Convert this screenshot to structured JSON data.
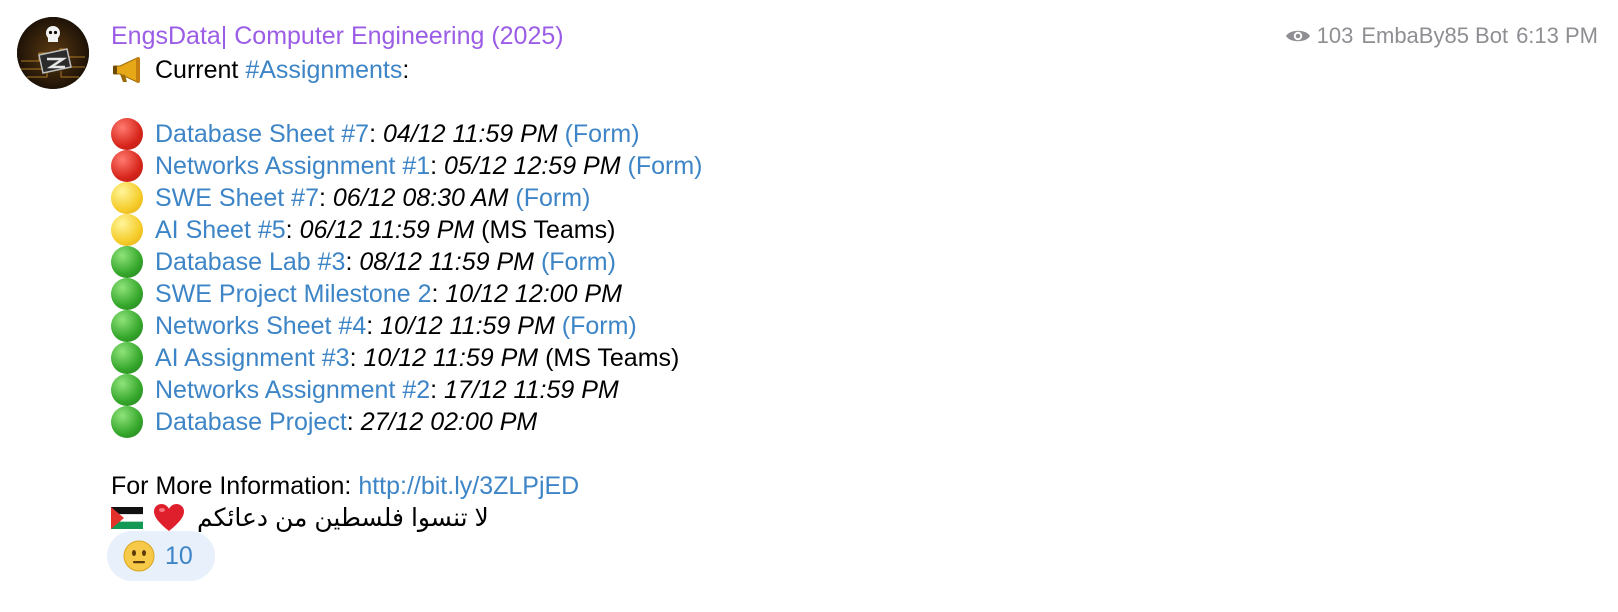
{
  "channel": {
    "name": "EngsData| Computer Engineering (2025)",
    "name_color": "#9b5de5"
  },
  "meta": {
    "views_icon": "eye-icon",
    "views": "103",
    "author": "EmbaBy85 Bot",
    "time": "6:13 PM"
  },
  "message": {
    "intro_icon": "megaphone-icon",
    "intro_prefix": "Current ",
    "intro_hashtag": "#Assignments",
    "intro_suffix": ":",
    "assignments": [
      {
        "status": "red",
        "title": "Database Sheet #7",
        "sep": ": ",
        "deadline": "04/12 11:59 PM",
        "extra": " (Form)",
        "extra_is_link": true
      },
      {
        "status": "red",
        "title": "Networks Assignment #1",
        "sep": ": ",
        "deadline": "05/12 12:59 PM",
        "extra": " (Form)",
        "extra_is_link": true
      },
      {
        "status": "yellow",
        "title": "SWE Sheet #7",
        "sep": ": ",
        "deadline": "06/12 08:30 AM",
        "extra": " (Form)",
        "extra_is_link": true
      },
      {
        "status": "yellow",
        "title": "AI Sheet #5",
        "sep": ": ",
        "deadline": "06/12 11:59 PM",
        "extra": " (MS Teams)",
        "extra_is_link": false
      },
      {
        "status": "green",
        "title": "Database Lab #3",
        "sep": ": ",
        "deadline": "08/12 11:59 PM",
        "extra": " (Form)",
        "extra_is_link": true
      },
      {
        "status": "green",
        "title": "SWE Project Milestone 2",
        "sep": ": ",
        "deadline": "10/12 12:00 PM",
        "extra": "",
        "extra_is_link": false
      },
      {
        "status": "green",
        "title": "Networks Sheet #4",
        "sep": ": ",
        "deadline": "10/12 11:59 PM",
        "extra": " (Form)",
        "extra_is_link": true
      },
      {
        "status": "green",
        "title": "AI Assignment #3",
        "sep": ": ",
        "deadline": "10/12 11:59 PM",
        "extra": " (MS Teams)",
        "extra_is_link": false
      },
      {
        "status": "green",
        "title": "Networks Assignment #2",
        "sep": ": ",
        "deadline": "17/12 11:59 PM",
        "extra": "",
        "extra_is_link": false
      },
      {
        "status": "green",
        "title": "Database Project",
        "sep": ": ",
        "deadline": "27/12 02:00 PM",
        "extra": "",
        "extra_is_link": false
      }
    ],
    "more_info_label": "For More Information: ",
    "more_info_link": "http://bit.ly/3ZLPjED",
    "closing_text": "لا تنسوا فلسطين من دعائكم",
    "closing_icons": [
      "palestine-flag-icon",
      "red-heart-icon"
    ]
  },
  "reaction": {
    "icon": "neutral-face-icon",
    "count": "10"
  },
  "colors": {
    "link": "#3d85c6",
    "meta": "#8e8e93",
    "reaction_bg": "#e8f0fb"
  }
}
